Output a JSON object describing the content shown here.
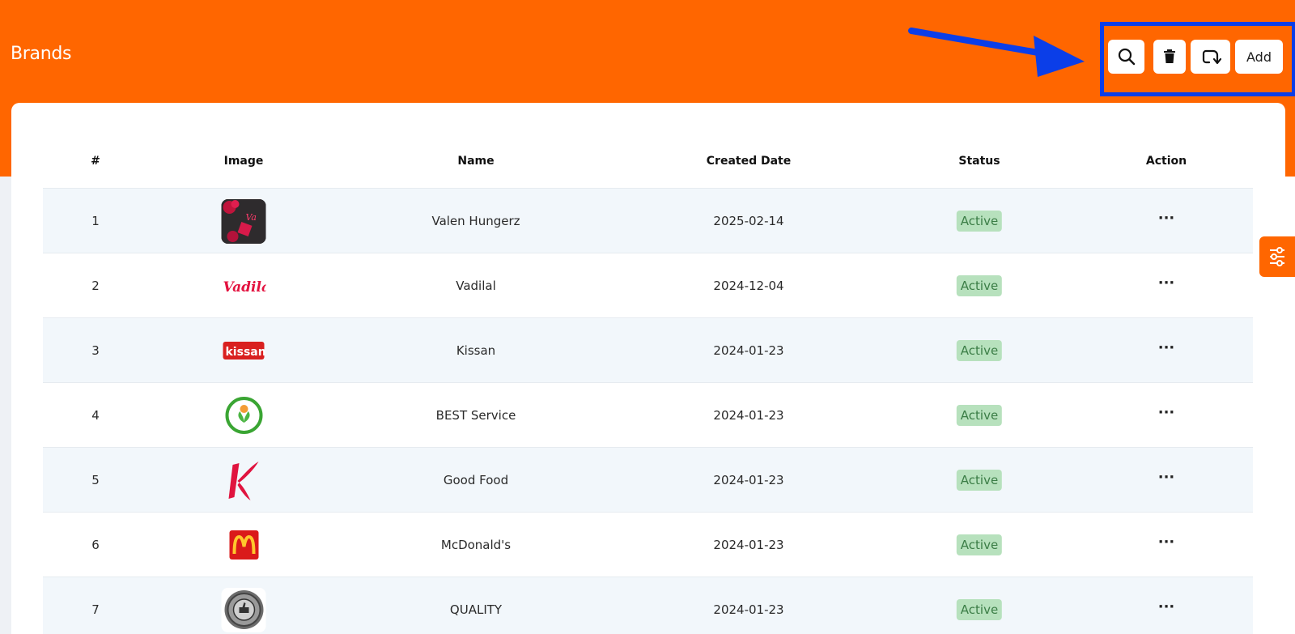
{
  "page": {
    "title": "Brands"
  },
  "toolbar": {
    "search_icon": "search-icon",
    "delete_icon": "trash-icon",
    "refresh_icon": "refresh-icon",
    "add_label": "Add"
  },
  "colors": {
    "brand_orange": "#ff6600",
    "highlight_blue": "#0b3ee8",
    "row_alt": "#f2f7fb",
    "badge_bg": "#b7e1bd",
    "badge_text": "#3b7d46"
  },
  "table": {
    "columns": [
      "#",
      "Image",
      "Name",
      "Created Date",
      "Status",
      "Action"
    ],
    "rows": [
      {
        "num": "1",
        "image": "valentine-logo",
        "name": "Valen Hungerz",
        "date": "2025-02-14",
        "status": "Active",
        "action": "•••"
      },
      {
        "num": "2",
        "image": "vadilal-logo",
        "name": "Vadilal",
        "date": "2024-12-04",
        "status": "Active",
        "action": "•••"
      },
      {
        "num": "3",
        "image": "kissan-logo",
        "name": "Kissan",
        "date": "2024-01-23",
        "status": "Active",
        "action": "•••"
      },
      {
        "num": "4",
        "image": "leaf-circle-logo",
        "name": "BEST Service",
        "date": "2024-01-23",
        "status": "Active",
        "action": "•••"
      },
      {
        "num": "5",
        "image": "kelloggs-k-logo",
        "name": "Good Food",
        "date": "2024-01-23",
        "status": "Active",
        "action": "•••"
      },
      {
        "num": "6",
        "image": "mcdonalds-logo",
        "name": "McDonald's",
        "date": "2024-01-23",
        "status": "Active",
        "action": "•••"
      },
      {
        "num": "7",
        "image": "quality-seal-logo",
        "name": "QUALITY",
        "date": "2024-01-23",
        "status": "Active",
        "action": "•••"
      }
    ]
  },
  "side_tab": {
    "icon": "sliders-icon"
  }
}
